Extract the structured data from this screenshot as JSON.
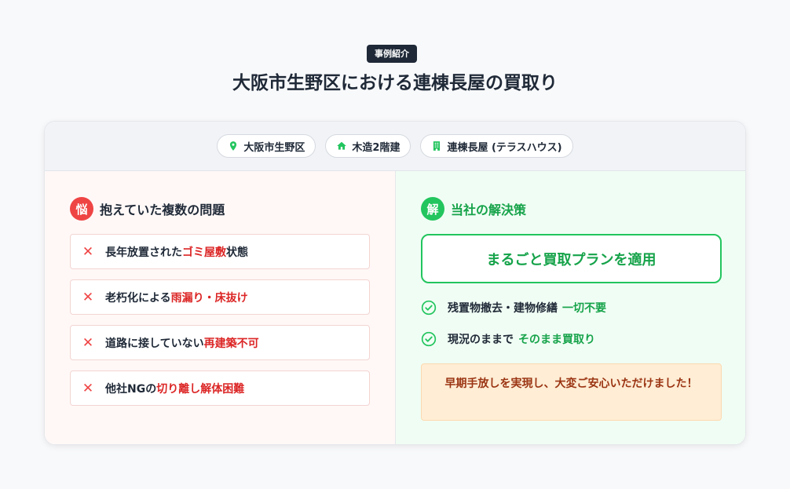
{
  "badge": "事例紹介",
  "title": "大阪市生野区における連棟長屋の買取り",
  "tags": [
    {
      "icon": "map-pin-icon",
      "label": "大阪市生野区"
    },
    {
      "icon": "home-icon",
      "label": "木造2階建"
    },
    {
      "icon": "building-icon",
      "label": "連棟長屋 (テラスハウス)"
    }
  ],
  "problems_section": {
    "icon_char": "悩",
    "heading": "抱えていた複数の問題",
    "items": [
      {
        "pre": "長年放置された",
        "hl": "ゴミ屋敷",
        "post": "状態"
      },
      {
        "pre": "老朽化による",
        "hl": "雨漏り・床抜け",
        "post": ""
      },
      {
        "pre": "道路に接していない",
        "hl": "再建築不可",
        "post": ""
      },
      {
        "pre": "他社NGの",
        "hl": "切り離し解体困難",
        "post": ""
      }
    ]
  },
  "solution_section": {
    "icon_char": "解",
    "heading": "当社の解決策",
    "plan": "まるごと買取プランを適用",
    "checks": [
      {
        "pre": "残置物撤去・建物修繕",
        "hl": "一切不要"
      },
      {
        "pre": "現況のままで",
        "hl": "そのまま買取り"
      }
    ],
    "note": "早期手放しを実現し、大変ご安心いただけました！"
  },
  "colors": {
    "accent_red": "#ef4444",
    "accent_green": "#22c55e",
    "dark": "#1f2937"
  },
  "icons": {
    "cross": "✕"
  }
}
